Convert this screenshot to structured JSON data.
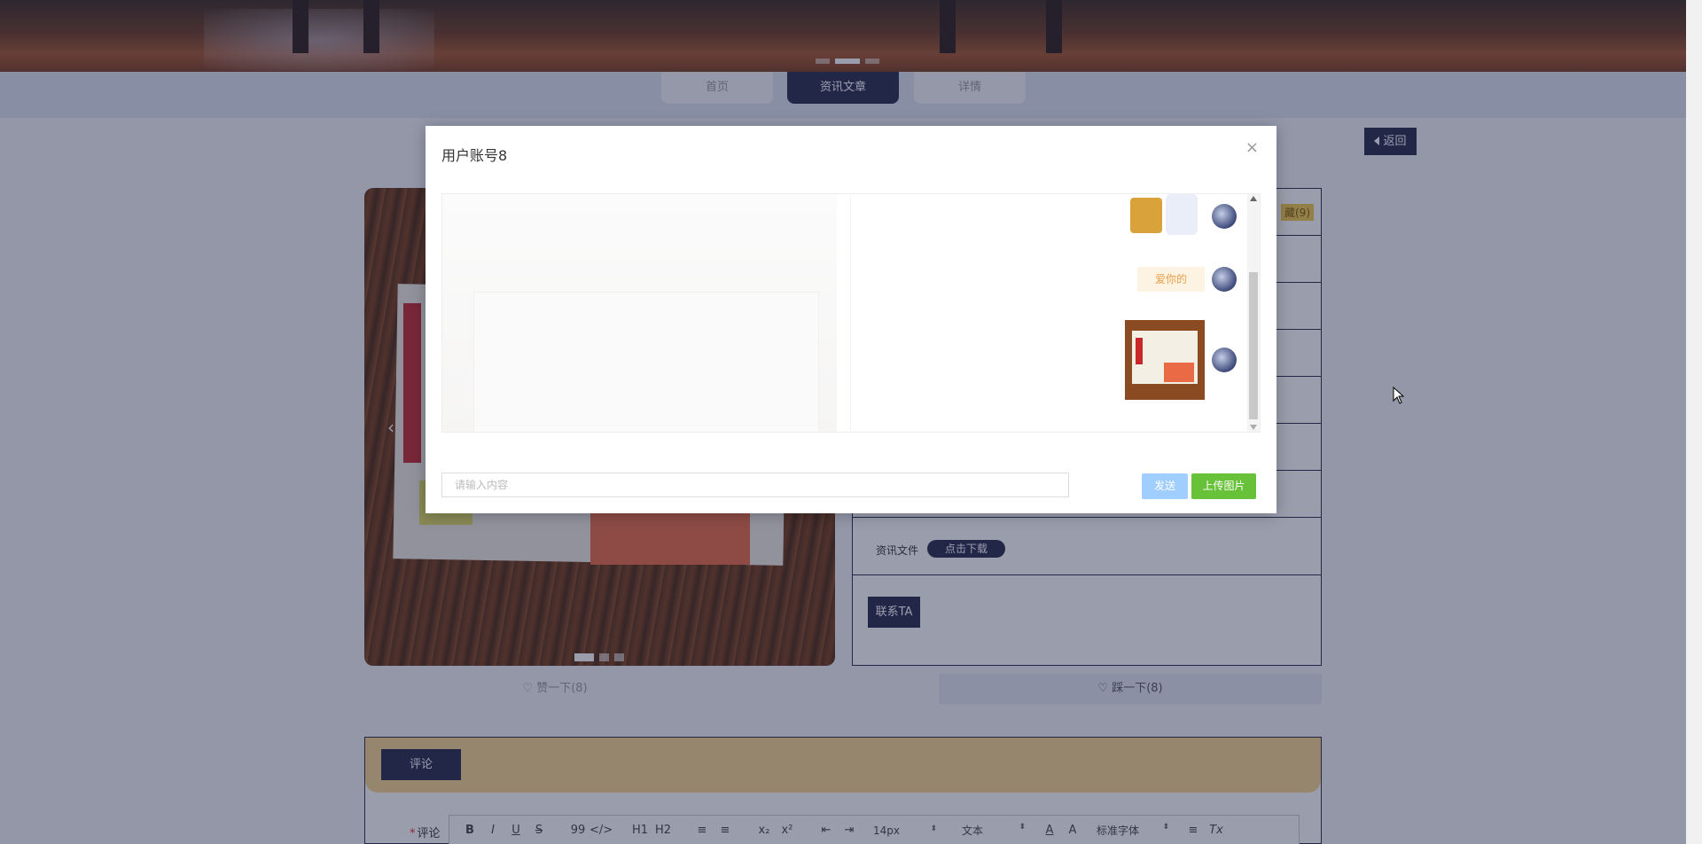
{
  "nav": {
    "tabs": [
      {
        "label": "首页"
      },
      {
        "label": "资讯文章"
      },
      {
        "label": "详情"
      }
    ]
  },
  "page": {
    "back_label": "返回",
    "badge_text": "藏(9)",
    "file_label": "资讯文件",
    "download_label": "点击下载",
    "contact_label": "联系TA",
    "like_label": "赞一下(8)",
    "dislike_label": "踩一下(8)",
    "comment_tab": "评论",
    "comment_field_label": "评论",
    "required_mark": "*"
  },
  "editor_toolbar": {
    "font_size": "14px",
    "block_type": "文本",
    "font_family": "标准字体",
    "buttons": [
      "B",
      "I",
      "U",
      "S",
      "99",
      "</>",
      "H1",
      "H2",
      "≡",
      "≡",
      "x₂",
      "x²",
      "⇤",
      "⇥",
      "A",
      "A",
      "≡",
      "Tx"
    ]
  },
  "modal": {
    "title": "用户账号8",
    "close_glyph": "×",
    "messages": [
      {
        "type": "sticker"
      },
      {
        "type": "text",
        "text": "爱你的"
      },
      {
        "type": "image"
      }
    ],
    "input_placeholder": "请输入内容",
    "send_label": "发送",
    "upload_label": "上传图片"
  },
  "colors": {
    "brand_dark": "#26294a",
    "send_disabled": "#a0cfff",
    "upload_green": "#67c23a",
    "comment_header": "#f6d58c"
  }
}
